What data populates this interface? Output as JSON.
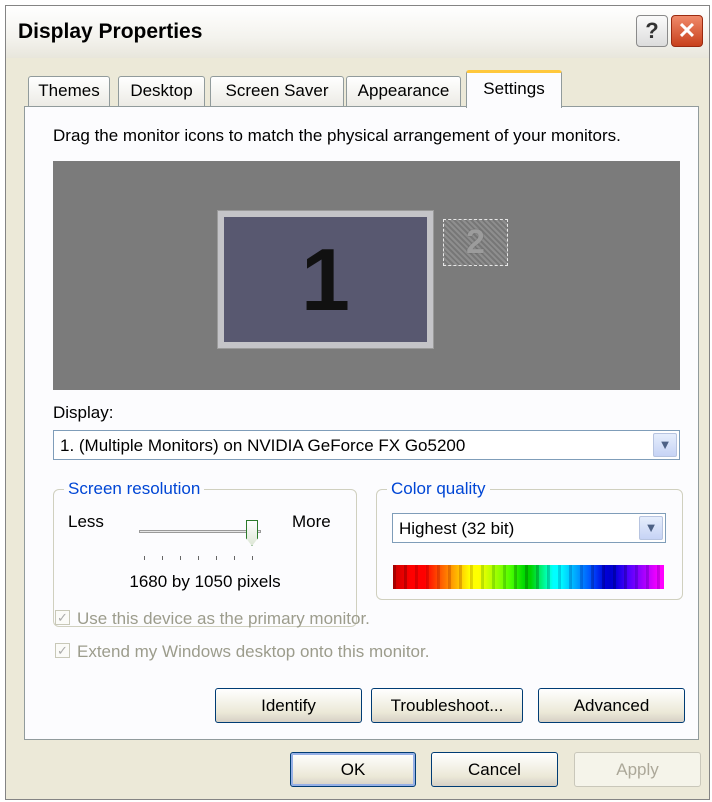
{
  "window": {
    "title": "Display Properties",
    "help_glyph": "?",
    "close_glyph": "✕"
  },
  "tabs": [
    {
      "label": "Themes",
      "active": false
    },
    {
      "label": "Desktop",
      "active": false
    },
    {
      "label": "Screen Saver",
      "active": false
    },
    {
      "label": "Appearance",
      "active": false
    },
    {
      "label": "Settings",
      "active": true
    }
  ],
  "settings": {
    "instruction": "Drag the monitor icons to match the physical arrangement of your monitors.",
    "monitors": {
      "primary": "1",
      "secondary": "2"
    },
    "display_label": "Display:",
    "display_value": "1. (Multiple Monitors) on NVIDIA GeForce FX Go5200",
    "screen_resolution": {
      "legend": "Screen resolution",
      "less_label": "Less",
      "more_label": "More",
      "value_text": "1680 by 1050 pixels",
      "slider_position": 1.0,
      "tick_count": 7
    },
    "color_quality": {
      "legend": "Color quality",
      "selected": "Highest (32 bit)"
    },
    "checkboxes": [
      {
        "label": "Use this device as the primary monitor.",
        "checked": true,
        "enabled": false
      },
      {
        "label": "Extend my Windows desktop onto this monitor.",
        "checked": true,
        "enabled": false
      }
    ],
    "buttons": {
      "identify": "Identify",
      "troubleshoot": "Troubleshoot...",
      "advanced": "Advanced"
    }
  },
  "footer": {
    "ok": "OK",
    "cancel": "Cancel",
    "apply": "Apply"
  },
  "colors": {
    "window_bg": "#ece9d8",
    "panel_bg": "#fcfcfe",
    "group_legend": "#0046d5",
    "active_tab_highlight": "#ffc83c",
    "monitor_area": "#7b7b7b"
  },
  "icons": {
    "dropdown": "chevron-down-icon",
    "check": "checkmark-icon",
    "help": "help-icon",
    "close": "close-icon"
  }
}
